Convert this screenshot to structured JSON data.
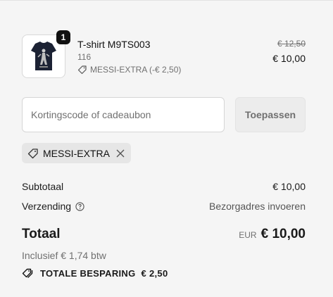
{
  "product": {
    "quantity_badge": "1",
    "name": "T-shirt M9TS003",
    "variant": "116",
    "discount_label": "MESSI-EXTRA (-€ 2,50)",
    "original_price": "€ 12,50",
    "price": "€ 10,00",
    "image_icon": "tshirt-icon"
  },
  "discount_form": {
    "placeholder": "Kortingscode of cadeaubon",
    "value": "",
    "apply_label": "Toepassen"
  },
  "applied_code": {
    "code": "MESSI-EXTRA",
    "tag_icon": "tag-icon",
    "remove_icon": "close-icon"
  },
  "summary": {
    "subtotal_label": "Subtotaal",
    "subtotal_value": "€ 10,00",
    "shipping_label": "Verzending",
    "shipping_info_icon": "question-circle-icon",
    "shipping_value": "Bezorgadres invoeren",
    "total_label": "Totaal",
    "currency": "EUR",
    "total_value": "€ 10,00",
    "tax_note": "Inclusief € 1,74 btw",
    "savings_label": "TOTALE BESPARING",
    "savings_value": "€ 2,50",
    "savings_icon": "tags-icon"
  },
  "colors": {
    "background": "#f5f5f5",
    "badge": "#111111",
    "muted_text": "#707070"
  }
}
